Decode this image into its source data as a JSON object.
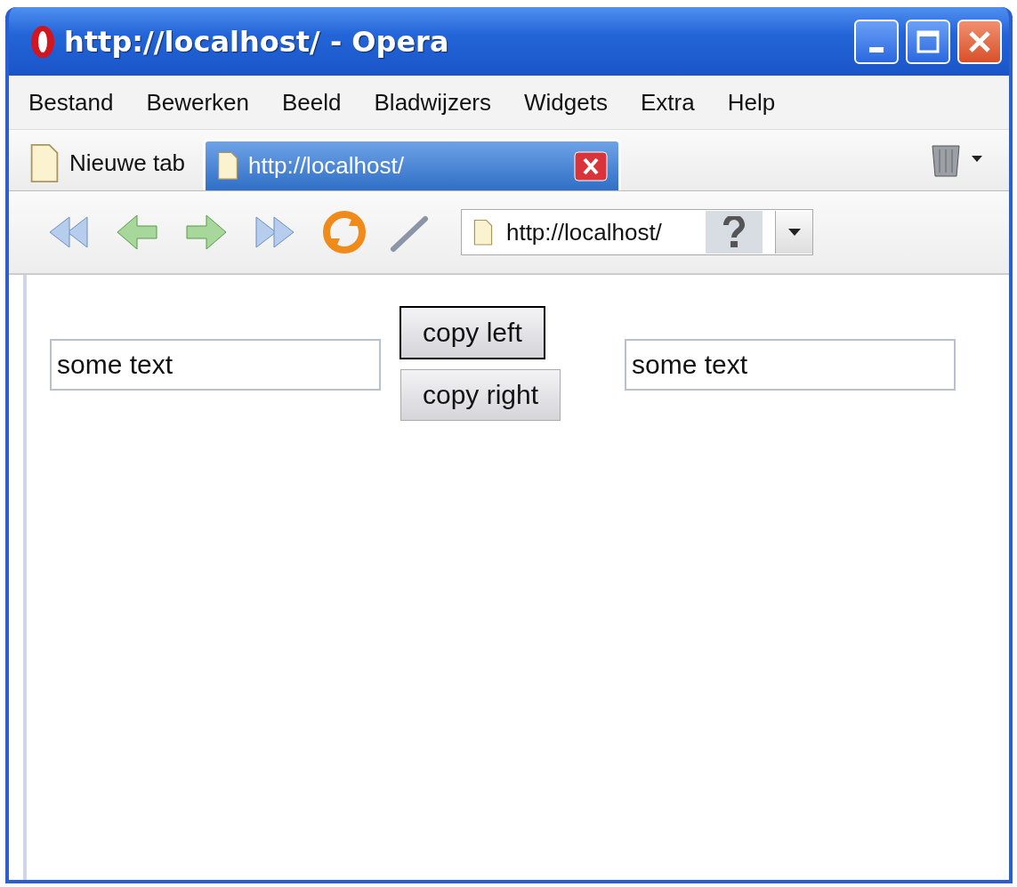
{
  "window": {
    "title": "http://localhost/ - Opera"
  },
  "menu": [
    {
      "label": "Bestand"
    },
    {
      "label": "Bewerken"
    },
    {
      "label": "Beeld"
    },
    {
      "label": "Bladwijzers"
    },
    {
      "label": "Widgets"
    },
    {
      "label": "Extra"
    },
    {
      "label": "Help"
    }
  ],
  "tabs": [
    {
      "kind": "new",
      "label": "Nieuwe tab",
      "selected": false
    },
    {
      "kind": "page",
      "label": "http://localhost/",
      "selected": true
    }
  ],
  "address": {
    "value": "http://localhost/"
  },
  "page": {
    "left_field": {
      "value": "some text"
    },
    "right_field": {
      "value": "some text"
    },
    "buttons": [
      {
        "label": "copy left",
        "focused": true
      },
      {
        "label": "copy right",
        "focused": false
      }
    ]
  }
}
